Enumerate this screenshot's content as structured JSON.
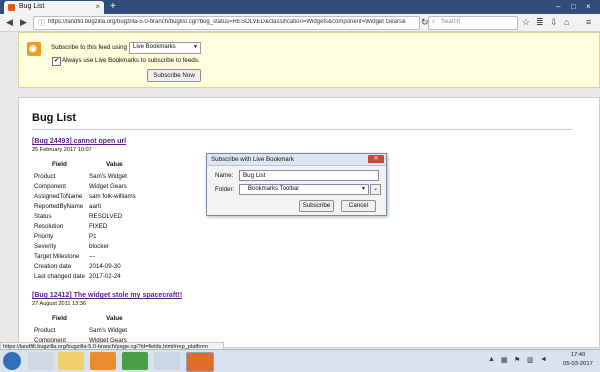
{
  "browser": {
    "tab_title": "Bug List",
    "new_tab": "+",
    "url": "https://landfill.bugzilla.org/bugzilla-5.0-branch/buglist.cgi?bug_status=RESOLVED&classification=Widgets&component=Widget Gears&",
    "search_placeholder": "Search"
  },
  "feed": {
    "subscribe_text": "Subscribe to this feed using",
    "selected_reader": "Live Bookmarks",
    "always_use_label": "Always use Live Bookmarks to subscribe to feeds.",
    "always_use_checked": true,
    "subscribe_button": "Subscribe Now"
  },
  "buglist": {
    "heading": "Bug List",
    "field_header": "Field",
    "value_header": "Value",
    "bugs": [
      {
        "title": "[Bug 24493] cannot open url",
        "date": "25 February 2017 10:07",
        "fields": [
          {
            "key": "Product",
            "value": "Sam's Widget"
          },
          {
            "key": "Component",
            "value": "Widget Gears"
          },
          {
            "key": "AssignedToName",
            "value": "sam folk-williams"
          },
          {
            "key": "ReportedByName",
            "value": "aarti"
          },
          {
            "key": "Status",
            "value": "RESOLVED"
          },
          {
            "key": "Resolution",
            "value": "FIXED"
          },
          {
            "key": "Priority",
            "value": "P1"
          },
          {
            "key": "Severity",
            "value": "blocker"
          },
          {
            "key": "Target Milestone",
            "value": "---"
          },
          {
            "key": "Creation date",
            "value": "2014-09-30"
          },
          {
            "key": "Last changed date",
            "value": "2017-02-24"
          }
        ]
      },
      {
        "title": "[Bug 12412] The widget stole my spacecraft!!",
        "date": "27 August 2011 13:36",
        "fields": [
          {
            "key": "Product",
            "value": "Sam's Widget"
          },
          {
            "key": "Component",
            "value": "Widget Gears"
          }
        ]
      }
    ]
  },
  "dialog": {
    "title": "Subscribe with Live Bookmark",
    "name_label": "Name:",
    "name_value": "Bug List",
    "folder_label": "Folder:",
    "folder_value": "Bookmarks Toolbar",
    "subscribe_button": "Subscribe",
    "cancel_button": "Cancel"
  },
  "status_url": "https://landfill.bugzilla.org/bugzilla-5.0-branch/page.cgi?id=fields.html#rep_platform",
  "taskbar": {
    "time": "17:40",
    "date": "05-03-2017"
  }
}
